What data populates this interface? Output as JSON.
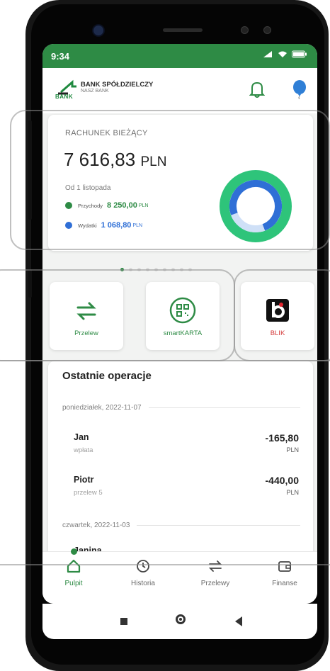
{
  "status": {
    "time": "9:34",
    "icons": "▮▮ ◠ ▭"
  },
  "header": {
    "logo_text": "BANK",
    "bank_name": "BANK SPÓŁDZIELCZY",
    "bank_subtitle": "NASZ BANK",
    "bell_icon": "bell-icon",
    "balloon_icon": "balloon-icon"
  },
  "account": {
    "title": "RACHUNEK BIEŻĄCY",
    "balance": "7 616,83",
    "currency": "PLN",
    "since": "Od 1 listopada",
    "income_label": "Przychody",
    "income_value": "8 250,00",
    "income_currency": "PLN",
    "expense_label": "Wydatki",
    "expense_value": "1 068,80",
    "expense_currency": "PLN",
    "income_color": "#2e8b45",
    "expense_color": "#2f6fd6"
  },
  "pager": {
    "count": 9,
    "active": 0
  },
  "actions": [
    {
      "label": "Przelew",
      "icon": "transfer-icon"
    },
    {
      "label": "smartKARTA",
      "icon": "qr-card-icon"
    },
    {
      "label": "BLIK",
      "icon": "blik-icon"
    }
  ],
  "operations": {
    "title": "Ostatnie operacje",
    "groups": [
      {
        "date": "poniedziałek, 2022-11-07",
        "items": [
          {
            "name": "Jan",
            "desc": "wpłata",
            "amount": "-165,80",
            "currency": "PLN"
          },
          {
            "name": "Piotr",
            "desc": "przelew 5",
            "amount": "-440,00",
            "currency": "PLN"
          }
        ]
      },
      {
        "date": "czwartek, 2022-11-03",
        "items": [
          {
            "name": "Janina"
          }
        ]
      }
    ]
  },
  "nav": [
    {
      "label": "Pulpit",
      "icon": "home-icon",
      "active": true
    },
    {
      "label": "Historia",
      "icon": "history-icon",
      "active": false
    },
    {
      "label": "Przelewy",
      "icon": "transfers-icon",
      "active": false
    },
    {
      "label": "Finanse",
      "icon": "wallet-icon",
      "active": false
    }
  ],
  "colors": {
    "brand": "#2e8b45",
    "blik_red": "#d43a3a"
  }
}
